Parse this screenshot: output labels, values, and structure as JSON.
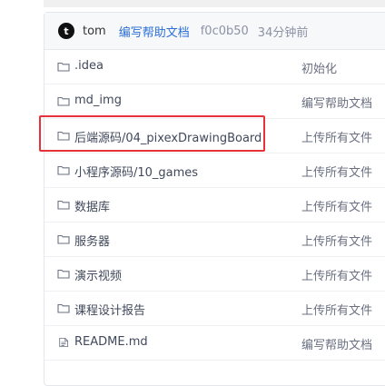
{
  "commit": {
    "avatar_letter": "t",
    "author": "tom",
    "message": "编写帮助文档",
    "hash": "f0c0b50",
    "time": "34分钟前"
  },
  "files": [
    {
      "name": ".idea",
      "desc": "初始化",
      "icon": "folder-icon"
    },
    {
      "name": "md_img",
      "desc": "编写帮助文档",
      "icon": "folder-icon"
    },
    {
      "name": "后端源码/04_pixexDrawingBoard",
      "desc": "上传所有文件",
      "icon": "folder-icon"
    },
    {
      "name": "小程序源码/10_games",
      "desc": "上传所有文件",
      "icon": "folder-icon"
    },
    {
      "name": "数据库",
      "desc": "上传所有文件",
      "icon": "folder-icon"
    },
    {
      "name": "服务器",
      "desc": "上传所有文件",
      "icon": "folder-icon"
    },
    {
      "name": "演示视频",
      "desc": "上传所有文件",
      "icon": "folder-icon"
    },
    {
      "name": "课程设计报告",
      "desc": "上传所有文件",
      "icon": "folder-icon"
    },
    {
      "name": "README.md",
      "desc": "编写帮助文档",
      "icon": "file-icon"
    }
  ],
  "colors": {
    "link": "#2b6fd6",
    "highlight_border": "#e6333a"
  }
}
